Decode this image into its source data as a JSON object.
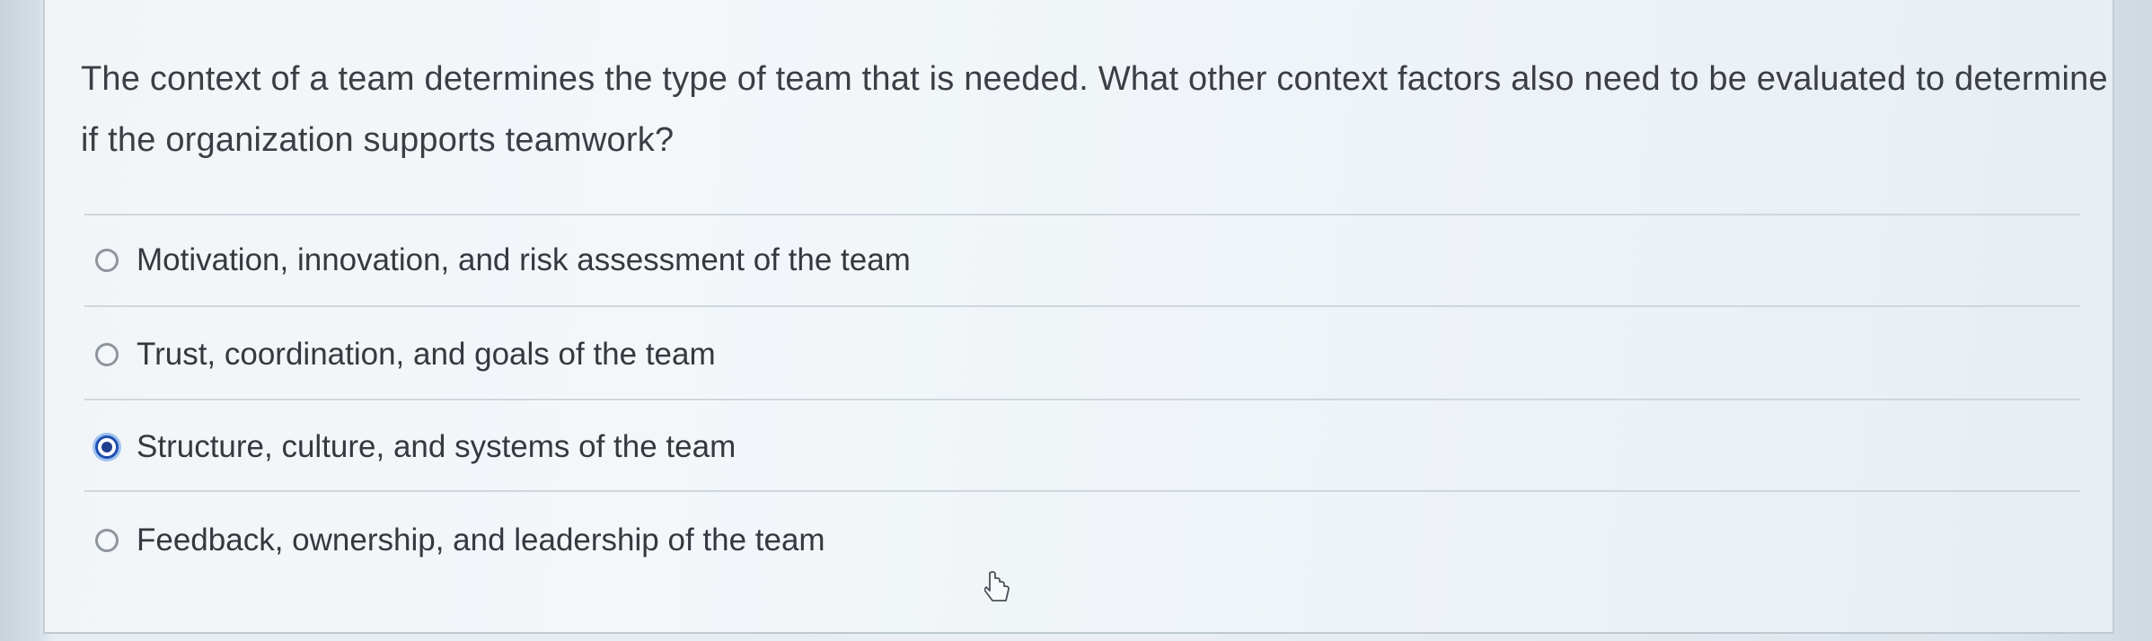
{
  "question": {
    "text": "The context of a team determines the type of team that is needed. What other context factors also need to be evaluated to determine if the organization supports teamwork?"
  },
  "options": [
    {
      "label": "Motivation, innovation, and risk assessment of the team",
      "selected": false
    },
    {
      "label": "Trust, coordination, and goals of the team",
      "selected": false
    },
    {
      "label": "Structure, culture, and systems of the team",
      "selected": true
    },
    {
      "label": "Feedback, ownership, and leadership of the team",
      "selected": false
    }
  ],
  "colors": {
    "selected_radio": "#1f3f8f",
    "text": "#3b3f45"
  },
  "icons": {
    "cursor": "mouse-pointer-icon"
  }
}
